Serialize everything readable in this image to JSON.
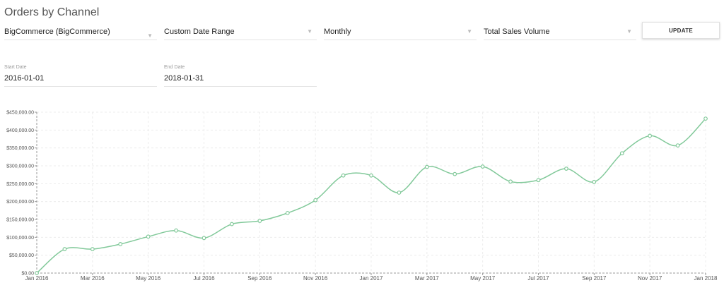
{
  "title": "Orders by Channel",
  "filters": {
    "channel": "BigCommerce (BigCommerce)",
    "date_range": "Custom Date Range",
    "interval": "Monthly",
    "metric": "Total Sales Volume"
  },
  "update_label": "UPDATE",
  "dates": {
    "start_label": "Start Date",
    "start_value": "2016-01-01",
    "end_label": "End Date",
    "end_value": "2018-01-31"
  },
  "chart_data": {
    "type": "line",
    "x": [
      "2016-01",
      "2016-02",
      "2016-03",
      "2016-04",
      "2016-05",
      "2016-06",
      "2016-07",
      "2016-08",
      "2016-09",
      "2016-10",
      "2016-11",
      "2016-12",
      "2017-01",
      "2017-02",
      "2017-03",
      "2017-04",
      "2017-05",
      "2017-06",
      "2017-07",
      "2017-08",
      "2017-09",
      "2017-10",
      "2017-11",
      "2017-12",
      "2018-01"
    ],
    "series": [
      {
        "values": [
          0,
          67000,
          67000,
          81000,
          102000,
          119000,
          98000,
          137000,
          146000,
          168000,
          204000,
          273000,
          273000,
          225000,
          297000,
          277000,
          298000,
          256000,
          260000,
          292000,
          255000,
          335000,
          384000,
          357000,
          432000
        ],
        "color": "#82c99a"
      }
    ],
    "x_tick_labels": [
      "Jan 2016",
      "Mar 2016",
      "May 2016",
      "Jul 2016",
      "Sep 2016",
      "Nov 2016",
      "Jan 2017",
      "Mar 2017",
      "May 2017",
      "Jul 2017",
      "Sep 2017",
      "Nov 2017",
      "Jan 2018"
    ],
    "y_tick_labels": [
      "$0.00",
      "$50,000.00",
      "$100,000.00",
      "$150,000.00",
      "$200,000.00",
      "$250,000.00",
      "$300,000.00",
      "$350,000.00",
      "$400,000.00",
      "$450,000.00"
    ],
    "ylim": [
      0,
      450000
    ],
    "grid": true,
    "title": "",
    "xlabel": "",
    "ylabel": ""
  }
}
